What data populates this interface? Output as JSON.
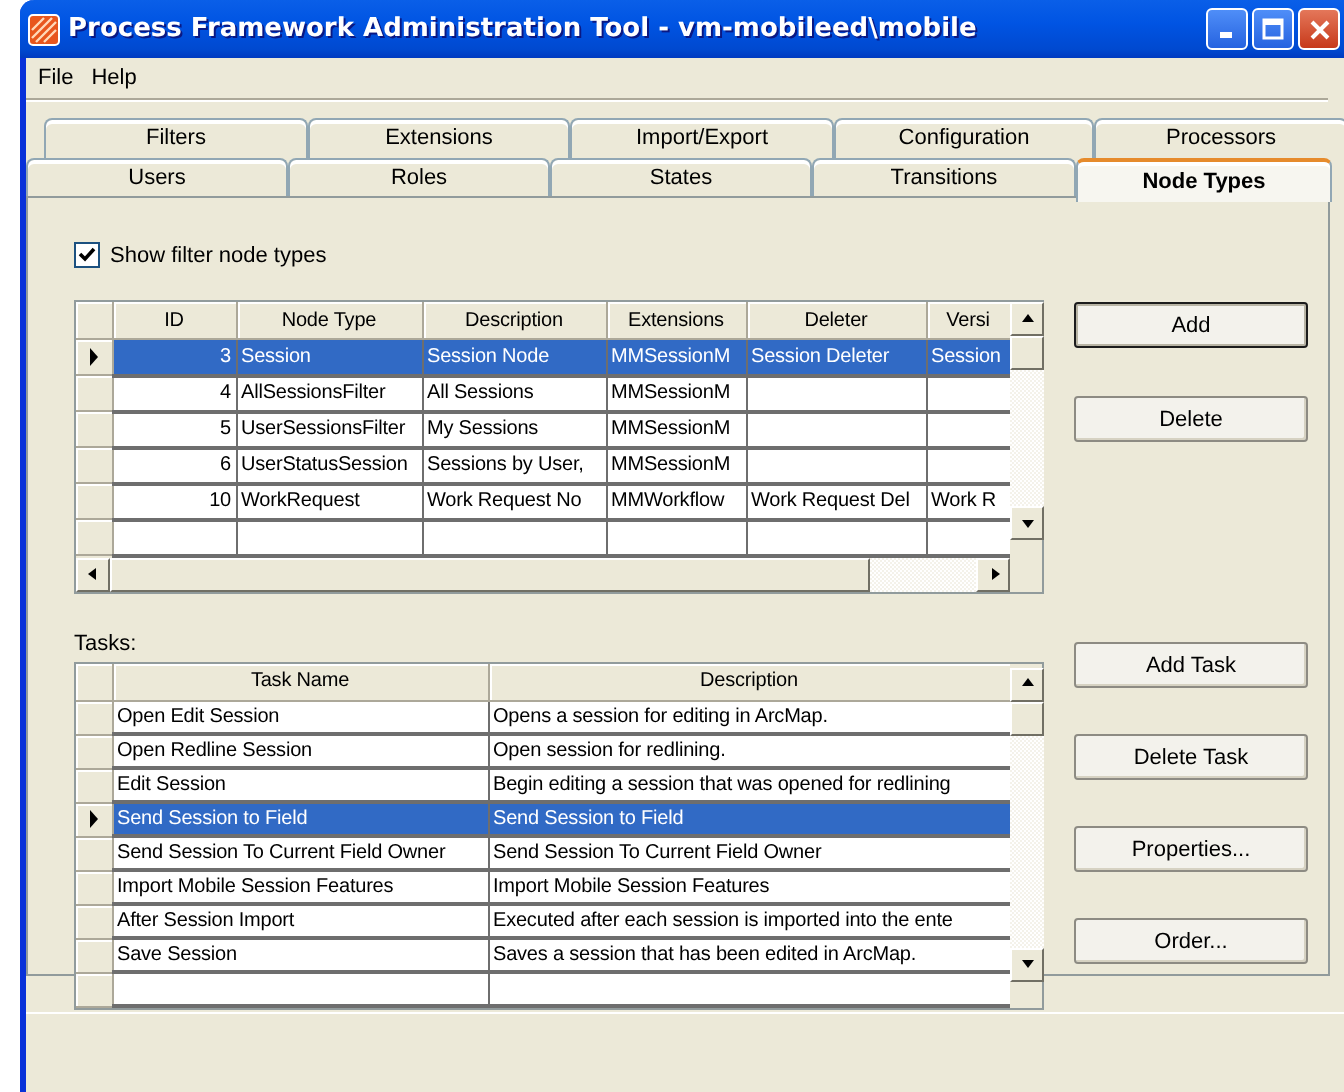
{
  "window": {
    "title": "Process Framework Administration Tool - vm-mobileed\\mobile"
  },
  "menu": [
    {
      "label": "File"
    },
    {
      "label": "Help"
    }
  ],
  "tab_rows": [
    {
      "tabs": [
        {
          "label": "Filters",
          "selected": false
        },
        {
          "label": "Extensions",
          "selected": false
        },
        {
          "label": "Import/Export",
          "selected": false
        },
        {
          "label": "Configuration",
          "selected": false
        },
        {
          "label": "Processors",
          "selected": false
        }
      ]
    },
    {
      "tabs": [
        {
          "label": "Users",
          "selected": false
        },
        {
          "label": "Roles",
          "selected": false
        },
        {
          "label": "States",
          "selected": false
        },
        {
          "label": "Transitions",
          "selected": false
        },
        {
          "label": "Node Types",
          "selected": true
        }
      ]
    }
  ],
  "show_filter_checkbox": {
    "label": "Show filter node types",
    "checked": true
  },
  "node_types": {
    "columns": [
      "ID",
      "Node Type",
      "Description",
      "Extensions",
      "Deleter",
      "Versi"
    ],
    "rows": [
      {
        "cells": [
          "3",
          "Session",
          "Session Node",
          "MMSessionM",
          "Session Deleter",
          "Session"
        ],
        "selected": true
      },
      {
        "cells": [
          "4",
          "AllSessionsFilter",
          "All Sessions",
          "MMSessionM",
          "",
          ""
        ],
        "selected": false
      },
      {
        "cells": [
          "5",
          "UserSessionsFilter",
          "My Sessions",
          "MMSessionM",
          "",
          ""
        ],
        "selected": false
      },
      {
        "cells": [
          "6",
          "UserStatusSession",
          "Sessions by User,",
          "MMSessionM",
          "",
          ""
        ],
        "selected": false
      },
      {
        "cells": [
          "10",
          "WorkRequest",
          "Work Request No",
          "MMWorkflow",
          "Work Request Del",
          "Work R"
        ],
        "selected": false
      }
    ]
  },
  "node_type_buttons": [
    {
      "label": "Add",
      "default": true
    },
    {
      "label": "Delete",
      "default": false
    }
  ],
  "tasks": {
    "label": "Tasks:",
    "columns": [
      "Task Name",
      "Description"
    ],
    "rows": [
      {
        "cells": [
          "Open Edit Session",
          "Opens a session for editing in ArcMap."
        ],
        "selected": false
      },
      {
        "cells": [
          "Open Redline Session",
          "Open session for redlining."
        ],
        "selected": false
      },
      {
        "cells": [
          "Edit Session",
          "Begin editing a session that was opened for redlining"
        ],
        "selected": false
      },
      {
        "cells": [
          "Send Session to Field",
          "Send Session to Field"
        ],
        "selected": true
      },
      {
        "cells": [
          "Send Session To Current Field Owner",
          "Send Session To Current Field Owner"
        ],
        "selected": false
      },
      {
        "cells": [
          "Import Mobile Session Features",
          "Import Mobile Session Features"
        ],
        "selected": false
      },
      {
        "cells": [
          "After Session Import",
          "Executed after each session is imported into the ente"
        ],
        "selected": false
      },
      {
        "cells": [
          "Save Session",
          "Saves a session that has been edited in ArcMap."
        ],
        "selected": false
      }
    ]
  },
  "task_buttons": [
    {
      "label": "Add Task",
      "default": false
    },
    {
      "label": "Delete Task",
      "default": false
    },
    {
      "label": "Properties...",
      "default": false
    },
    {
      "label": "Order...",
      "default": false
    }
  ]
}
